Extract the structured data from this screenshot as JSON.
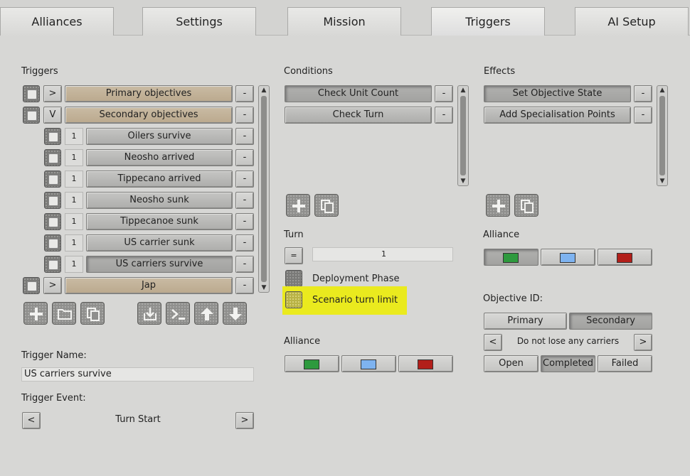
{
  "tabs": [
    "Alliances",
    "Settings",
    "Mission",
    "Triggers",
    "AI Setup"
  ],
  "triggers": {
    "heading": "Triggers",
    "rows": [
      {
        "toggle": ">",
        "label": "Primary objectives",
        "remove": "-"
      },
      {
        "toggle": "V",
        "label": "Secondary objectives",
        "remove": "-"
      },
      {
        "num": "1",
        "label": "Oilers survive",
        "remove": "-"
      },
      {
        "num": "1",
        "label": "Neosho arrived",
        "remove": "-"
      },
      {
        "num": "1",
        "label": "Tippecano arrived",
        "remove": "-"
      },
      {
        "num": "1",
        "label": "Neosho sunk",
        "remove": "-"
      },
      {
        "num": "1",
        "label": "Tippecanoe sunk",
        "remove": "-"
      },
      {
        "num": "1",
        "label": "US carrier sunk",
        "remove": "-"
      },
      {
        "num": "1",
        "label": "US carriers survive",
        "remove": "-"
      },
      {
        "toggle": ">",
        "label": "Jap",
        "remove": "-"
      }
    ],
    "name_label": "Trigger Name:",
    "name_value": "US carriers survive",
    "event_label": "Trigger Event:",
    "event_value": "Turn Start",
    "prev": "<",
    "next": ">"
  },
  "conditions": {
    "heading": "Conditions",
    "items": [
      "Check Unit Count",
      "Check Turn"
    ],
    "remove": "-",
    "turn_label": "Turn",
    "turn_operator": "=",
    "turn_value": "1",
    "deployment_phase": "Deployment Phase",
    "scenario_turn_limit": "Scenario turn limit",
    "alliance_label": "Alliance"
  },
  "effects": {
    "heading": "Effects",
    "items": [
      "Set Objective State",
      "Add Specialisation Points"
    ],
    "remove": "-",
    "alliance_label": "Alliance",
    "objective_id_label": "Objective ID:",
    "objective_types": [
      "Primary",
      "Secondary"
    ],
    "objective_value": "Do not lose any carriers",
    "prev": "<",
    "next": ">",
    "states": [
      "Open",
      "Completed",
      "Failed"
    ]
  },
  "colors": {
    "alliance_green": "#2e9a3e",
    "alliance_blue": "#7eb3f0",
    "alliance_red": "#b21f1a",
    "highlight_yellow": "#eaea1e",
    "group_row_tan": "#c4b49b"
  },
  "icons": [
    "add-icon",
    "folder-icon",
    "copy-icon",
    "import-icon",
    "console-icon",
    "arrow-up-icon",
    "arrow-down-icon"
  ]
}
